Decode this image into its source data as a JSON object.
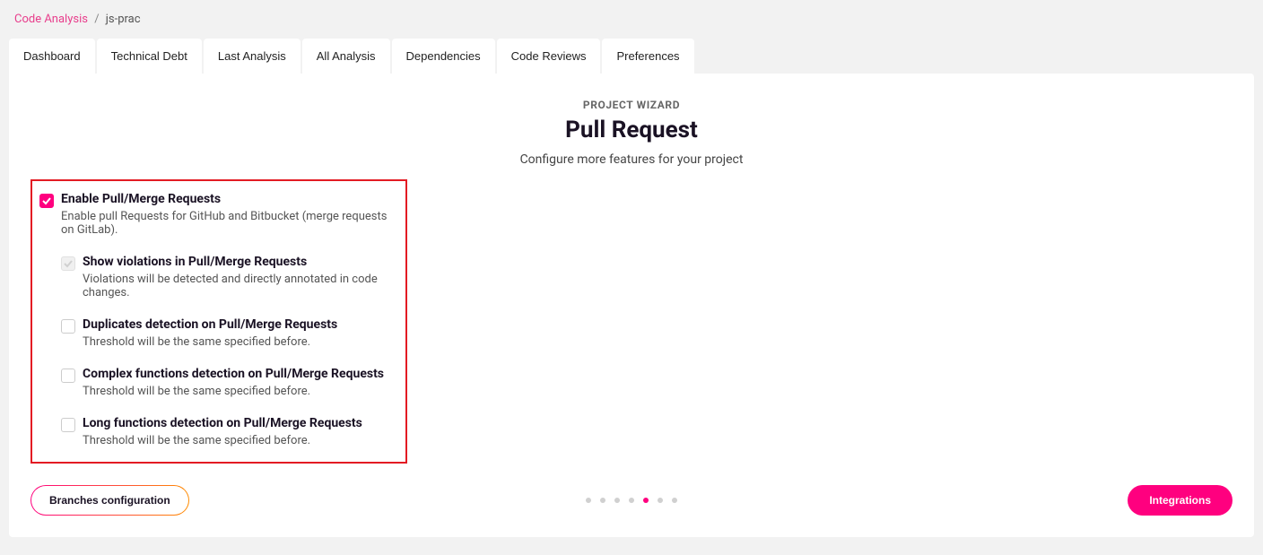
{
  "breadcrumb": {
    "root": "Code Analysis",
    "leaf": "js-prac"
  },
  "tabs": [
    {
      "label": "Dashboard"
    },
    {
      "label": "Technical Debt"
    },
    {
      "label": "Last Analysis"
    },
    {
      "label": "All Analysis"
    },
    {
      "label": "Dependencies"
    },
    {
      "label": "Code Reviews"
    },
    {
      "label": "Preferences"
    }
  ],
  "wizard": {
    "eyebrow": "PROJECT WIZARD",
    "title": "Pull Request",
    "subtitle": "Configure more features for your project"
  },
  "options": {
    "root": {
      "title": "Enable Pull/Merge Requests",
      "desc": "Enable pull Requests for GitHub and Bitbucket (merge requests on GitLab).",
      "checked": true
    },
    "children": [
      {
        "title": "Show violations in Pull/Merge Requests",
        "desc": "Violations will be detected and directly annotated in code changes.",
        "state": "dim"
      },
      {
        "title": "Duplicates detection on Pull/Merge Requests",
        "desc": "Threshold will be the same specified before.",
        "state": "off"
      },
      {
        "title": "Complex functions detection on Pull/Merge Requests",
        "desc": "Threshold will be the same specified before.",
        "state": "off"
      },
      {
        "title": "Long functions detection on Pull/Merge Requests",
        "desc": "Threshold will be the same specified before.",
        "state": "off"
      }
    ]
  },
  "footer": {
    "back_label": "Branches configuration",
    "next_label": "Integrations"
  },
  "steps": {
    "count": 7,
    "active_index": 4
  }
}
